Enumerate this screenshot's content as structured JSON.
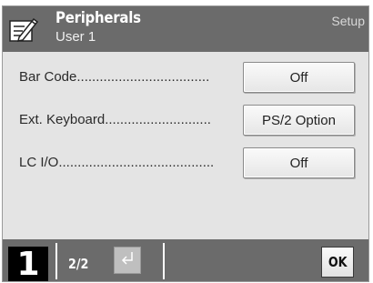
{
  "header": {
    "title": "Peripherals",
    "user": "User 1",
    "context": "Setup",
    "icon": "edit-settings-icon"
  },
  "rows": [
    {
      "label": "Bar Code...................................",
      "value": "Off"
    },
    {
      "label": "Ext. Keyboard............................",
      "value": "PS/2 Option"
    },
    {
      "label": "LC I/O.........................................",
      "value": "Off"
    }
  ],
  "footer": {
    "user_number": "1",
    "page": "2/2",
    "nav_icon": "return-arrow-icon",
    "ok_label": "OK"
  },
  "colors": {
    "bar": "#6b6b6b",
    "background": "#e4e4e4",
    "user_box": "#000000"
  }
}
